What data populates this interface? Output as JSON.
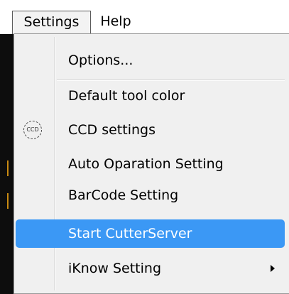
{
  "menubar": {
    "items": [
      {
        "label": "Settings",
        "open": true
      },
      {
        "label": "Help"
      }
    ]
  },
  "menu": {
    "items": [
      {
        "label": "Options..."
      },
      {
        "label": "Default tool color"
      },
      {
        "label": "CCD settings",
        "icon": "ccd-icon",
        "icon_text": "CCD"
      },
      {
        "label": "Auto Oparation Setting"
      },
      {
        "label": "BarCode Setting"
      },
      {
        "label": "Start CutterServer",
        "highlighted": true
      },
      {
        "label": "iKnow Setting",
        "submenu": true
      }
    ]
  },
  "colors": {
    "highlight": "#3b98f5",
    "menu_background": "#f0f0f0"
  }
}
